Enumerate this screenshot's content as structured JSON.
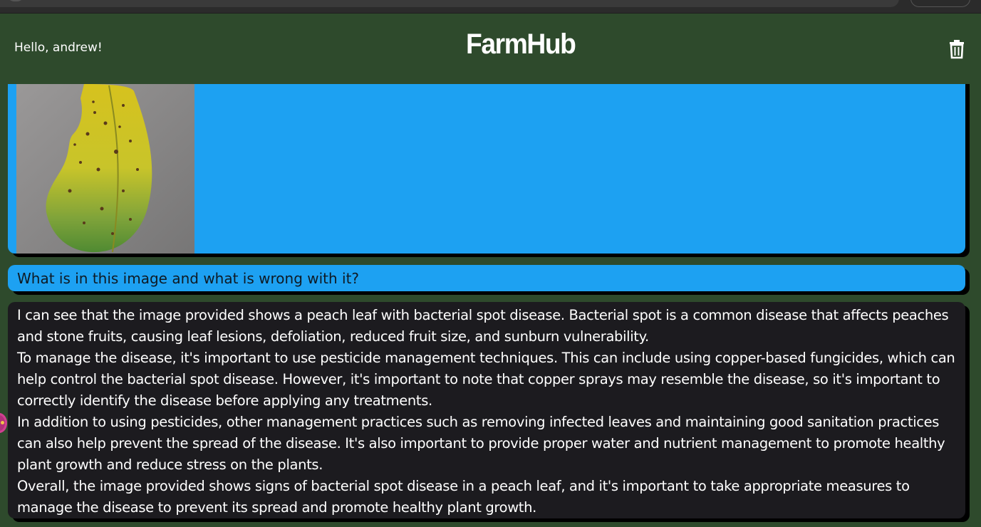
{
  "header": {
    "greeting": "Hello, andrew!",
    "logo": "FarmHub",
    "trash_icon": "trash-icon"
  },
  "chat": {
    "image_message": {
      "image_description_icon": "leaf-photo"
    },
    "user_message": "What is in this image and what is wrong with it?",
    "bot_paragraphs": [
      "I can see that the image provided shows a peach leaf with bacterial spot disease. Bacterial spot is a common disease that affects peaches and stone fruits, causing leaf lesions, defoliation, reduced fruit size, and sunburn vulnerability.",
      "To manage the disease, it's important to use pesticide management techniques. This can include using copper-based fungicides, which can help control the bacterial spot disease. However, it's important to note that copper sprays may resemble the disease, so it's important to correctly identify the disease before applying any treatments.",
      "In addition to using pesticides, other management practices such as removing infected leaves and maintaining good sanitation practices can also help prevent the spread of the disease. It's also important to provide proper water and nutrient management to promote healthy plant growth and reduce stress on the plants.",
      "Overall, the image provided shows signs of bacterial spot disease in a peach leaf, and it's important to take appropriate measures to manage the disease to prevent its spread and promote healthy plant growth."
    ]
  },
  "colors": {
    "header_bg": "#2e4a2c",
    "user_bubble": "#1da1f2",
    "bot_bubble": "#1c1b1f"
  }
}
